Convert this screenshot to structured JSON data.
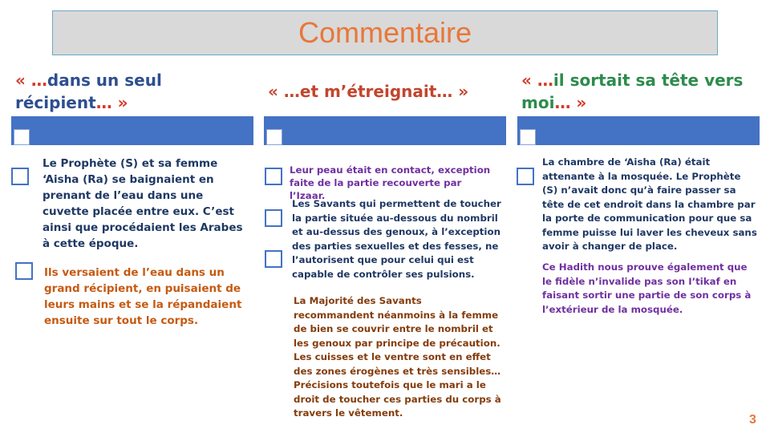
{
  "title": "Commentaire",
  "columns": [
    {
      "heading_quote": "« …dans un seul récipient… »",
      "paragraphs": [
        "Le Prophète (S) et sa femme ‘Aisha (Ra) se baignaient en prenant de l’eau dans une cuvette placée entre eux. C’est ainsi que procédaient les Arabes à cette époque.",
        "Ils versaient de l’eau dans un grand récipient, en puisaient de leurs mains et se la répandaient ensuite sur tout le corps."
      ]
    },
    {
      "heading_quote": "« …et m’étreignait… »",
      "paragraphs": [
        "Leur peau était en contact, exception faite de la partie recouverte par l’Izaar.",
        "Les Savants qui permettent de toucher la partie située au-dessous du nombril et au-dessus des genoux, à l’exception des parties sexuelles et des fesses, ne l’autorisent que pour celui qui est capable de contrôler ses pulsions.",
        "La Majorité des Savants recommandent néanmoins à la femme de bien se couvrir entre le nombril et les genoux par principe de précaution. Les cuisses et le ventre sont en effet des zones érogènes et très sensibles… Précisions toutefois que le mari a le droit de toucher ces parties du corps à travers le vêtement."
      ]
    },
    {
      "heading_quote": "« …il sortait sa tête vers moi… »",
      "paragraphs": [
        "La chambre de ‘Aisha (Ra) était attenante à la mosquée. Le Prophète (S) n’avait donc qu’à faire passer sa tête de cet endroit dans la chambre par la porte de communication pour que sa femme puisse lui laver les cheveux sans avoir à changer de place.",
        "Ce Hadith nous prouve également que le fidèle n’invalide pas son I’tikaf en faisant sortir une partie de son corps à l’extérieur de la mosquée."
      ]
    }
  ],
  "page_number": "3",
  "colors": {
    "accent": "#e8773a",
    "bar": "#4472c4"
  }
}
